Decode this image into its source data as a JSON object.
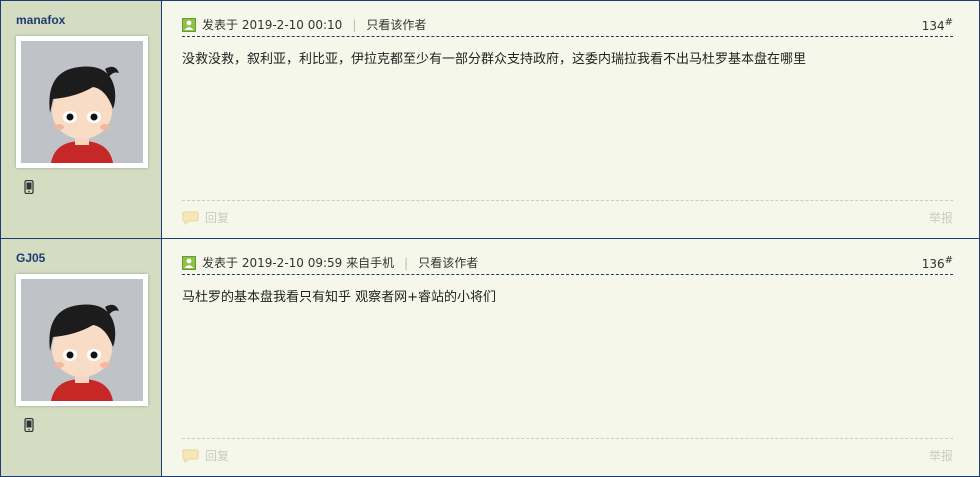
{
  "posts": [
    {
      "author": "manafox",
      "date_label": "发表于 2019-2-10 00:10",
      "only_author": "只看该作者",
      "floor": "134",
      "floor_mark": "#",
      "content": "没救没救，叙利亚，利比亚，伊拉克都至少有一部分群众支持政府，这委内瑞拉我看不出马杜罗基本盘在哪里",
      "reply_label": "回复",
      "report_label": "举报"
    },
    {
      "author": "GJ05",
      "date_label": "发表于 2019-2-10 09:59 来自手机",
      "only_author": "只看该作者",
      "floor": "136",
      "floor_mark": "#",
      "content": "马杜罗的基本盘我看只有知乎 观察者网+睿站的小将们",
      "reply_label": "回复",
      "report_label": "举报"
    }
  ],
  "colors": {
    "border": "#1F3B73",
    "author_bg": "#D4DCC1",
    "content_bg": "#F4F7EA",
    "name": "#1F3B73"
  },
  "icons": [
    "online-icon",
    "phone-icon",
    "reply-icon",
    "avatar-icon"
  ]
}
